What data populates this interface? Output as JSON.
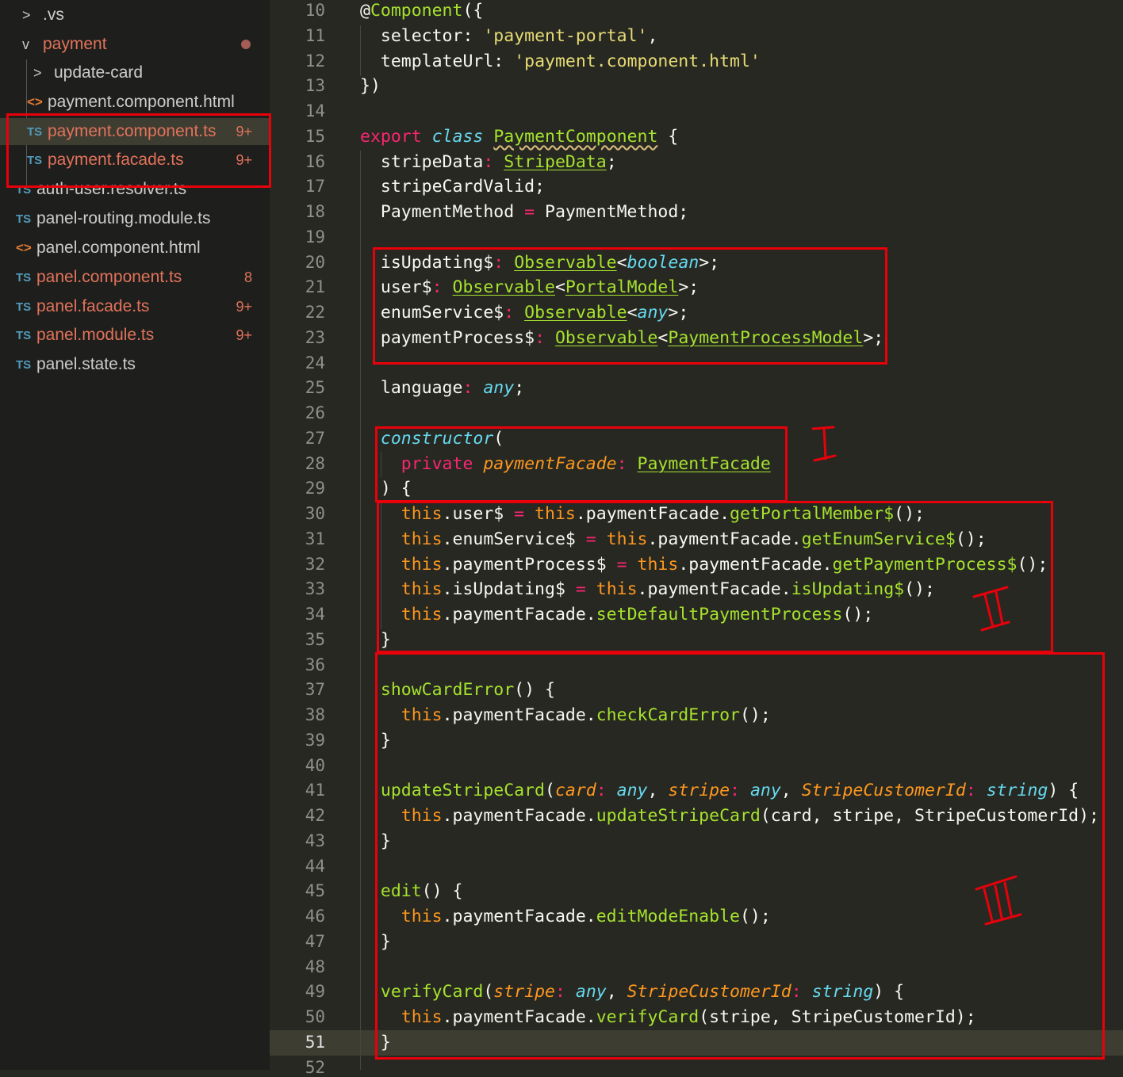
{
  "explorer": {
    "items": [
      {
        "label": ".vs",
        "icon": "chevron-right-icon",
        "modified": false,
        "badge": ""
      },
      {
        "label": "payment",
        "icon": "chevron-down-icon",
        "modified": true,
        "badge": ""
      },
      {
        "label": "update-card",
        "icon": "chevron-right-icon",
        "modified": false,
        "badge": ""
      },
      {
        "label": "payment.component.html",
        "icon": "html-file-icon",
        "modified": false,
        "badge": ""
      },
      {
        "label": "payment.component.ts",
        "icon": "ts-file-icon",
        "modified": true,
        "badge": "9+"
      },
      {
        "label": "payment.facade.ts",
        "icon": "ts-file-icon",
        "modified": true,
        "badge": "9+"
      },
      {
        "label": "auth-user.resolver.ts",
        "icon": "ts-file-icon",
        "modified": false,
        "badge": ""
      },
      {
        "label": "panel-routing.module.ts",
        "icon": "ts-file-icon",
        "modified": false,
        "badge": ""
      },
      {
        "label": "panel.component.html",
        "icon": "html-file-icon",
        "modified": false,
        "badge": ""
      },
      {
        "label": "panel.component.ts",
        "icon": "ts-file-icon",
        "modified": true,
        "badge": "8"
      },
      {
        "label": "panel.facade.ts",
        "icon": "ts-file-icon",
        "modified": true,
        "badge": "9+"
      },
      {
        "label": "panel.module.ts",
        "icon": "ts-file-icon",
        "modified": true,
        "badge": "9+"
      },
      {
        "label": "panel.state.ts",
        "icon": "ts-file-icon",
        "modified": false,
        "badge": ""
      }
    ],
    "ts_label": "TS",
    "html_glyph": "<>",
    "chev_right": ">",
    "chev_down": "v"
  },
  "editor": {
    "current_line": "51",
    "lines": [
      {
        "n": "10",
        "t": [
          [
            "@",
            "p"
          ],
          [
            "Component",
            "fn"
          ],
          [
            "({",
            "p"
          ]
        ]
      },
      {
        "n": "11",
        "t": [
          [
            "  selector",
            "p"
          ],
          [
            ":",
            "p"
          ],
          [
            " ",
            "p"
          ],
          [
            "'payment-portal'",
            "str"
          ],
          [
            ",",
            "p"
          ]
        ]
      },
      {
        "n": "12",
        "t": [
          [
            "  templateUrl",
            "p"
          ],
          [
            ":",
            "p"
          ],
          [
            " ",
            "p"
          ],
          [
            "'payment.component.html'",
            "str"
          ]
        ]
      },
      {
        "n": "13",
        "t": [
          [
            "})",
            "p"
          ]
        ]
      },
      {
        "n": "14",
        "t": []
      },
      {
        "n": "15",
        "t": [
          [
            "export",
            "kw"
          ],
          [
            " ",
            "p"
          ],
          [
            "class",
            "it"
          ],
          [
            " ",
            "p"
          ],
          [
            "PaymentComponent",
            "tyw"
          ],
          [
            " {",
            "p"
          ]
        ]
      },
      {
        "n": "16",
        "t": [
          [
            "  stripeData",
            "p"
          ],
          [
            ":",
            "kw"
          ],
          [
            " ",
            "p"
          ],
          [
            "StripeData",
            "ty"
          ],
          [
            ";",
            "p"
          ]
        ]
      },
      {
        "n": "17",
        "t": [
          [
            "  stripeCardValid;",
            "p"
          ]
        ]
      },
      {
        "n": "18",
        "t": [
          [
            "  PaymentMethod ",
            "p"
          ],
          [
            "=",
            "kw"
          ],
          [
            " PaymentMethod;",
            "p"
          ]
        ]
      },
      {
        "n": "19",
        "t": []
      },
      {
        "n": "20",
        "t": [
          [
            "  isUpdating$",
            "p"
          ],
          [
            ":",
            "kw"
          ],
          [
            " ",
            "p"
          ],
          [
            "Observable",
            "ty"
          ],
          [
            "<",
            "p"
          ],
          [
            "boolean",
            "it"
          ],
          [
            ">;",
            "p"
          ]
        ]
      },
      {
        "n": "21",
        "t": [
          [
            "  user$",
            "p"
          ],
          [
            ":",
            "kw"
          ],
          [
            " ",
            "p"
          ],
          [
            "Observable",
            "ty"
          ],
          [
            "<",
            "p"
          ],
          [
            "PortalModel",
            "ty"
          ],
          [
            ">;",
            "p"
          ]
        ]
      },
      {
        "n": "22",
        "t": [
          [
            "  enumService$",
            "p"
          ],
          [
            ":",
            "kw"
          ],
          [
            " ",
            "p"
          ],
          [
            "Observable",
            "ty"
          ],
          [
            "<",
            "p"
          ],
          [
            "any",
            "it"
          ],
          [
            ">;",
            "p"
          ]
        ]
      },
      {
        "n": "23",
        "t": [
          [
            "  paymentProcess$",
            "p"
          ],
          [
            ":",
            "kw"
          ],
          [
            " ",
            "p"
          ],
          [
            "Observable",
            "ty"
          ],
          [
            "<",
            "p"
          ],
          [
            "PaymentProcessModel",
            "ty"
          ],
          [
            ">;",
            "p"
          ]
        ]
      },
      {
        "n": "24",
        "t": []
      },
      {
        "n": "25",
        "t": [
          [
            "  language",
            "p"
          ],
          [
            ":",
            "kw"
          ],
          [
            " ",
            "p"
          ],
          [
            "any",
            "it"
          ],
          [
            ";",
            "p"
          ]
        ]
      },
      {
        "n": "26",
        "t": []
      },
      {
        "n": "27",
        "t": [
          [
            "  ",
            "p"
          ],
          [
            "constructor",
            "it"
          ],
          [
            "(",
            "p"
          ]
        ]
      },
      {
        "n": "28",
        "t": [
          [
            "    ",
            "p"
          ],
          [
            "private",
            "kw"
          ],
          [
            " ",
            "p"
          ],
          [
            "paymentFacade",
            "pa"
          ],
          [
            ":",
            "kw"
          ],
          [
            " ",
            "p"
          ],
          [
            "PaymentFacade",
            "ty"
          ]
        ]
      },
      {
        "n": "29",
        "t": [
          [
            "  ) {",
            "p"
          ]
        ]
      },
      {
        "n": "30",
        "t": [
          [
            "    ",
            "p"
          ],
          [
            "this",
            "th"
          ],
          [
            ".user$ ",
            "p"
          ],
          [
            "=",
            "kw"
          ],
          [
            " ",
            "p"
          ],
          [
            "this",
            "th"
          ],
          [
            ".paymentFacade.",
            "p"
          ],
          [
            "getPortalMember$",
            "fn"
          ],
          [
            "();",
            "p"
          ]
        ]
      },
      {
        "n": "31",
        "t": [
          [
            "    ",
            "p"
          ],
          [
            "this",
            "th"
          ],
          [
            ".enumService$ ",
            "p"
          ],
          [
            "=",
            "kw"
          ],
          [
            " ",
            "p"
          ],
          [
            "this",
            "th"
          ],
          [
            ".paymentFacade.",
            "p"
          ],
          [
            "getEnumService$",
            "fn"
          ],
          [
            "();",
            "p"
          ]
        ]
      },
      {
        "n": "32",
        "t": [
          [
            "    ",
            "p"
          ],
          [
            "this",
            "th"
          ],
          [
            ".paymentProcess$ ",
            "p"
          ],
          [
            "=",
            "kw"
          ],
          [
            " ",
            "p"
          ],
          [
            "this",
            "th"
          ],
          [
            ".paymentFacade.",
            "p"
          ],
          [
            "getPaymentProcess$",
            "fn"
          ],
          [
            "();",
            "p"
          ]
        ]
      },
      {
        "n": "33",
        "t": [
          [
            "    ",
            "p"
          ],
          [
            "this",
            "th"
          ],
          [
            ".isUpdating$ ",
            "p"
          ],
          [
            "=",
            "kw"
          ],
          [
            " ",
            "p"
          ],
          [
            "this",
            "th"
          ],
          [
            ".paymentFacade.",
            "p"
          ],
          [
            "isUpdating$",
            "fn"
          ],
          [
            "();",
            "p"
          ]
        ]
      },
      {
        "n": "34",
        "t": [
          [
            "    ",
            "p"
          ],
          [
            "this",
            "th"
          ],
          [
            ".paymentFacade.",
            "p"
          ],
          [
            "setDefaultPaymentProcess",
            "fn"
          ],
          [
            "();",
            "p"
          ]
        ]
      },
      {
        "n": "35",
        "t": [
          [
            "  }",
            "p"
          ]
        ]
      },
      {
        "n": "36",
        "t": []
      },
      {
        "n": "37",
        "t": [
          [
            "  ",
            "p"
          ],
          [
            "showCardError",
            "fn"
          ],
          [
            "() {",
            "p"
          ]
        ]
      },
      {
        "n": "38",
        "t": [
          [
            "    ",
            "p"
          ],
          [
            "this",
            "th"
          ],
          [
            ".paymentFacade.",
            "p"
          ],
          [
            "checkCardError",
            "fn"
          ],
          [
            "();",
            "p"
          ]
        ]
      },
      {
        "n": "39",
        "t": [
          [
            "  }",
            "p"
          ]
        ]
      },
      {
        "n": "40",
        "t": []
      },
      {
        "n": "41",
        "t": [
          [
            "  ",
            "p"
          ],
          [
            "updateStripeCard",
            "fn"
          ],
          [
            "(",
            "p"
          ],
          [
            "card",
            "pa"
          ],
          [
            ":",
            "kw"
          ],
          [
            " ",
            "p"
          ],
          [
            "any",
            "it"
          ],
          [
            ", ",
            "p"
          ],
          [
            "stripe",
            "pa"
          ],
          [
            ":",
            "kw"
          ],
          [
            " ",
            "p"
          ],
          [
            "any",
            "it"
          ],
          [
            ", ",
            "p"
          ],
          [
            "StripeCustomerId",
            "pa"
          ],
          [
            ":",
            "kw"
          ],
          [
            " ",
            "p"
          ],
          [
            "string",
            "it"
          ],
          [
            ") {",
            "p"
          ]
        ]
      },
      {
        "n": "42",
        "t": [
          [
            "    ",
            "p"
          ],
          [
            "this",
            "th"
          ],
          [
            ".paymentFacade.",
            "p"
          ],
          [
            "updateStripeCard",
            "fn"
          ],
          [
            "(card, stripe, StripeCustomerId);",
            "p"
          ]
        ]
      },
      {
        "n": "43",
        "t": [
          [
            "  }",
            "p"
          ]
        ]
      },
      {
        "n": "44",
        "t": []
      },
      {
        "n": "45",
        "t": [
          [
            "  ",
            "p"
          ],
          [
            "edit",
            "fn"
          ],
          [
            "() {",
            "p"
          ]
        ]
      },
      {
        "n": "46",
        "t": [
          [
            "    ",
            "p"
          ],
          [
            "this",
            "th"
          ],
          [
            ".paymentFacade.",
            "p"
          ],
          [
            "editModeEnable",
            "fn"
          ],
          [
            "();",
            "p"
          ]
        ]
      },
      {
        "n": "47",
        "t": [
          [
            "  }",
            "p"
          ]
        ]
      },
      {
        "n": "48",
        "t": []
      },
      {
        "n": "49",
        "t": [
          [
            "  ",
            "p"
          ],
          [
            "verifyCard",
            "fn"
          ],
          [
            "(",
            "p"
          ],
          [
            "stripe",
            "pa"
          ],
          [
            ":",
            "kw"
          ],
          [
            " ",
            "p"
          ],
          [
            "any",
            "it"
          ],
          [
            ", ",
            "p"
          ],
          [
            "StripeCustomerId",
            "pa"
          ],
          [
            ":",
            "kw"
          ],
          [
            " ",
            "p"
          ],
          [
            "string",
            "it"
          ],
          [
            ") {",
            "p"
          ]
        ]
      },
      {
        "n": "50",
        "t": [
          [
            "    ",
            "p"
          ],
          [
            "this",
            "th"
          ],
          [
            ".paymentFacade.",
            "p"
          ],
          [
            "verifyCard",
            "fn"
          ],
          [
            "(stripe, StripeCustomerId);",
            "p"
          ]
        ]
      },
      {
        "n": "51",
        "t": [
          [
            "  }",
            "p"
          ]
        ]
      },
      {
        "n": "52",
        "t": []
      }
    ]
  },
  "colors": {
    "keyword": "#f92672",
    "type": "#a6e22e",
    "string": "#e6db74",
    "param": "#fd971f",
    "builtin": "#66d9ef",
    "annotation_red": "#e8000b"
  },
  "annotations": [
    "I",
    "II",
    "III"
  ]
}
